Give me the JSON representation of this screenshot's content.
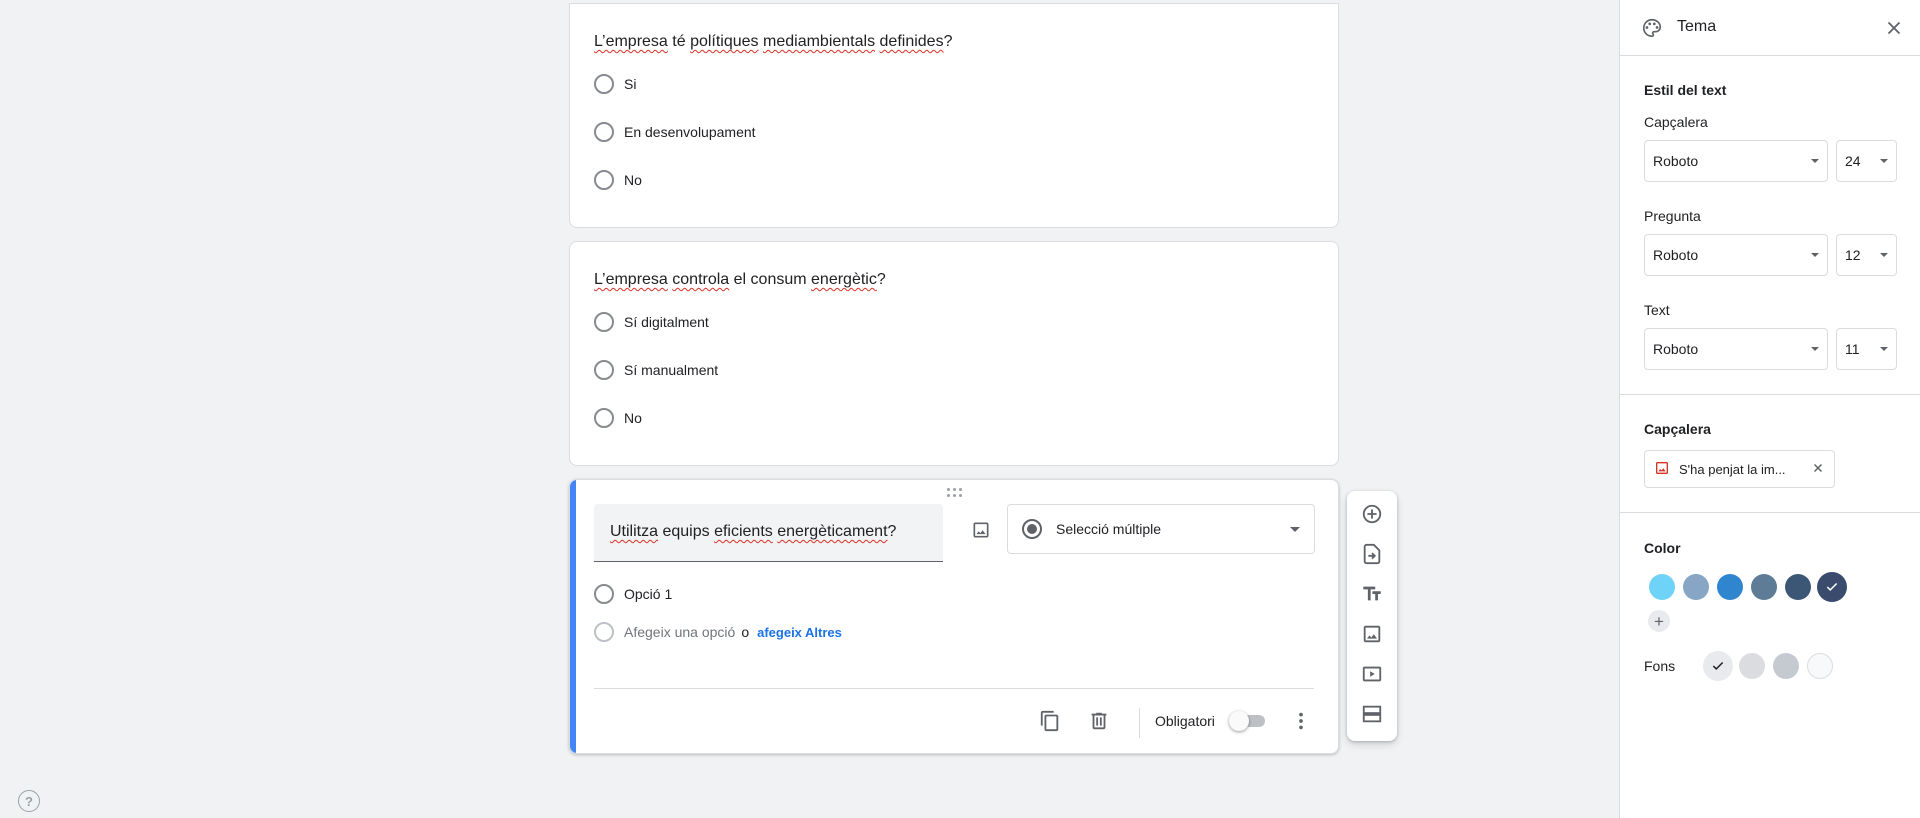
{
  "questions": [
    {
      "title_parts": [
        "L’empresa",
        " té ",
        "polítiques",
        " ",
        "mediambientals",
        " ",
        "definides",
        "?"
      ],
      "options": [
        "Si",
        "En desenvolupament",
        "No"
      ]
    },
    {
      "title_parts": [
        "L’empresa",
        " ",
        "controla",
        " el consum ",
        "energètic",
        "?"
      ],
      "options": [
        "Sí digitalment",
        "Sí manualment",
        "No"
      ]
    }
  ],
  "active_question": {
    "title_parts": [
      "Utilitza",
      " equips ",
      "eficients",
      " ",
      "energèticament",
      "?"
    ],
    "type_label": "Selecció múltiple",
    "option_1": "Opció 1",
    "add_option_placeholder": "Afegeix una opció",
    "or_text": "o",
    "add_other_link": "afegeix Altres",
    "required_label": "Obligatori",
    "required_on": false
  },
  "theme_panel": {
    "title": "Tema",
    "text_style_heading": "Estil del text",
    "header_label": "Capçalera",
    "header_font": "Roboto",
    "header_size": "24",
    "question_label": "Pregunta",
    "question_font": "Roboto",
    "question_size": "12",
    "text_label": "Text",
    "text_font": "Roboto",
    "text_size": "11",
    "header_image_heading": "Capçalera",
    "header_image_chip": "S'ha penjat la im...",
    "color_heading": "Color",
    "colors": [
      "#6fd3f7",
      "#87a5c4",
      "#2f86cf",
      "#5f7c96",
      "#3c5776",
      "#3b4b6e"
    ],
    "selected_color_index": 5,
    "background_label": "Fons",
    "backgrounds": [
      "#e8eaed",
      "#dadce0",
      "#c5cad1",
      "#f8f9fa"
    ],
    "selected_background_index": 0
  },
  "help": "?"
}
